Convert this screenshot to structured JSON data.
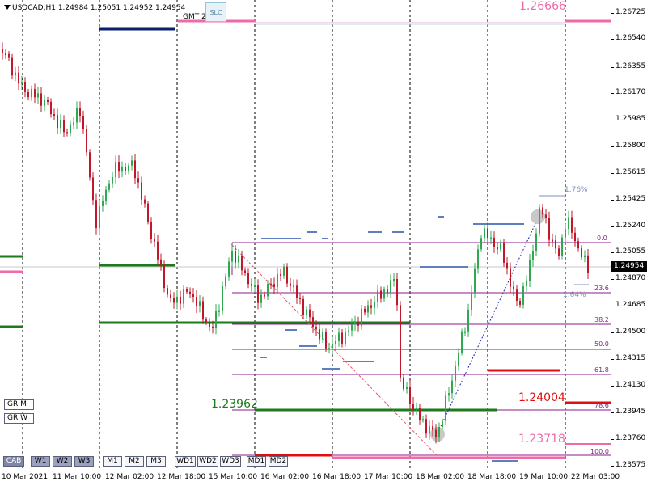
{
  "chart_title": "USDCAD,H1  1.24984 1.25051 1.24952 1.24954",
  "gmt_label": "GMT 2",
  "slc_label": "SLC",
  "current_price": "1.24954",
  "price_ticks": [
    "1.26725",
    "1.26540",
    "1.26355",
    "1.26170",
    "1.25985",
    "1.25800",
    "1.25615",
    "1.25425",
    "1.25240",
    "1.25055",
    "1.24870",
    "1.24685",
    "1.24500",
    "1.24315",
    "1.24130",
    "1.23945",
    "1.23760",
    "1.23575"
  ],
  "time_labels": [
    "10 Mar 2021",
    "11 Mar 10:00",
    "12 Mar 02:00",
    "12 Mar 18:00",
    "15 Mar 10:00",
    "16 Mar 02:00",
    "16 Mar 18:00",
    "17 Mar 10:00",
    "18 Mar 02:00",
    "18 Mar 18:00",
    "19 Mar 10:00",
    "22 Mar 03:00"
  ],
  "price_labels": {
    "top_pink": "1.26666",
    "green_level": "1.23962",
    "red_level": "1.24004",
    "bottom_pink": "1.23718"
  },
  "fib_levels": [
    "0.0",
    "23.6",
    "38.2",
    "50.0",
    "61.8",
    "78.6",
    "100.0"
  ],
  "percent_labels": [
    "1.76%",
    "1.64%"
  ],
  "gr_buttons": [
    "GR M",
    "GR W"
  ],
  "timeframe_buttons": [
    "CAB",
    "W1",
    "W2",
    "W3",
    "M1",
    "M2",
    "M3",
    "WD1",
    "WD2",
    "WD3",
    "MD1",
    "MD2"
  ],
  "colors": {
    "bull": "#2fa84f",
    "bear": "#c0182a",
    "fib": "#8b1a8b",
    "pink": "#f06aa8",
    "navy": "#0b1e6e",
    "green_line": "#1d7a1d",
    "red_line": "#e01010",
    "blue_dash": "#5d7fc0"
  }
}
